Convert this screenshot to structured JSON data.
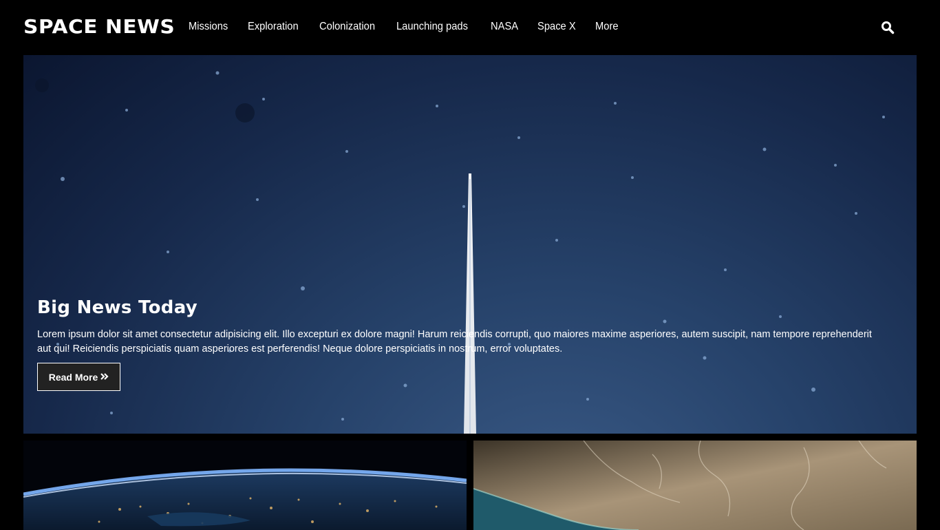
{
  "header": {
    "logo": "SPACE NEWS",
    "nav": [
      "Missions",
      "Exploration",
      "Colonization",
      "Launching pads",
      "NASA",
      "Space X",
      "More"
    ],
    "search_icon": "search-icon"
  },
  "hero": {
    "title": "Big News Today",
    "text": "Lorem ipsum dolor sit amet consectetur adipisicing elit. Illo excepturi ex dolore magni! Harum reiciendis corrupti, quo maiores maxime asperiores, autem suscipit, nam tempore reprehenderit aut qui! Reiciendis perspiciatis quam asperiores est perferendis! Neque dolore perspiciatis in nostrum, error voluptates.",
    "button_label": "Read More",
    "button_icon": "double-chevron-right-icon"
  },
  "cards": {
    "left_image": "earth-at-night-image",
    "right_image": "desert-coastline-satellite-image"
  },
  "colors": {
    "background": "#000000",
    "hero_sky": "#26426a",
    "button_bg": "#222222"
  }
}
